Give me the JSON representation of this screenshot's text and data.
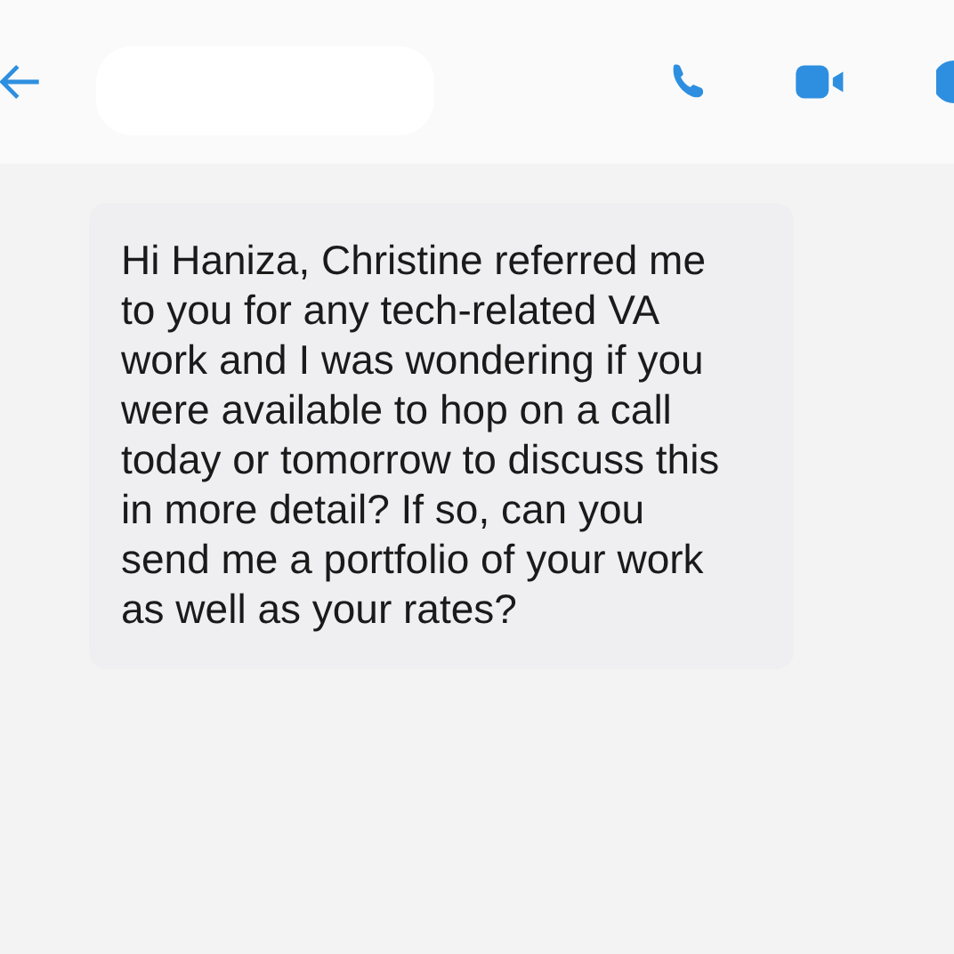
{
  "message": {
    "text": "Hi Haniza, Christine referred me to you for any tech-related VA work and I was wondering if you were available to hop on a call today or tomorrow to discuss this in more detail? If so, can you send me a portfolio of your work as well as your rates?"
  }
}
